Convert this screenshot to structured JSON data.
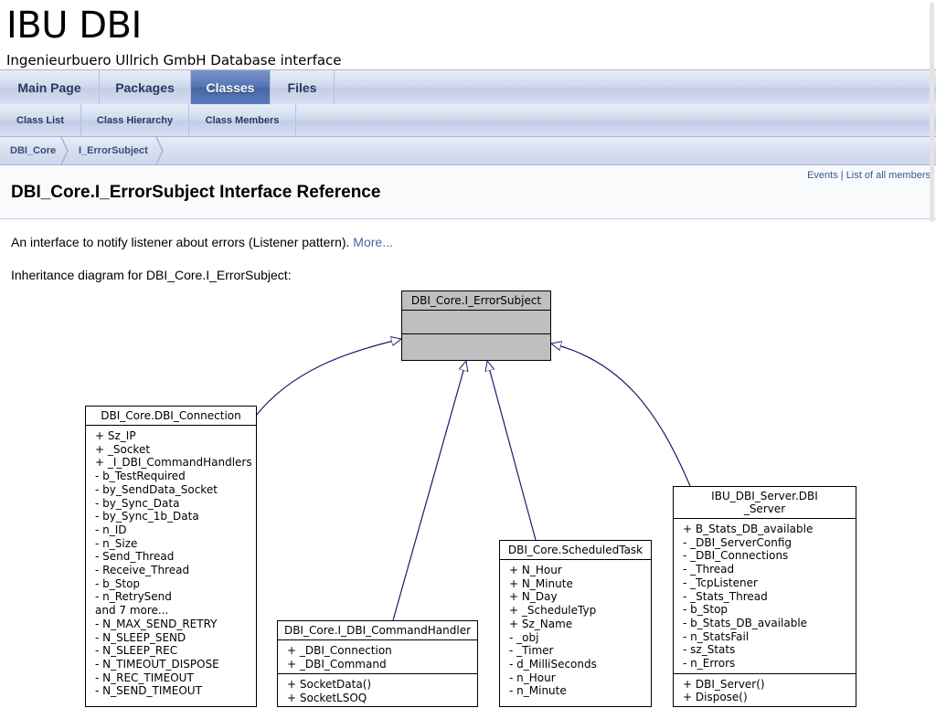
{
  "project": {
    "name": "IBU DBI",
    "brief": "Ingenieurbuero Ullrich GmbH Database interface"
  },
  "tabs": [
    {
      "label": "Main Page",
      "current": false
    },
    {
      "label": "Packages",
      "current": false
    },
    {
      "label": "Classes",
      "current": true
    },
    {
      "label": "Files",
      "current": false
    }
  ],
  "subtabs": [
    {
      "label": "Class List"
    },
    {
      "label": "Class Hierarchy"
    },
    {
      "label": "Class Members"
    }
  ],
  "breadcrumb": [
    "DBI_Core",
    "I_ErrorSubject"
  ],
  "summary": {
    "events": "Events",
    "separator": " | ",
    "all_members": "List of all members"
  },
  "title": "DBI_Core.I_ErrorSubject Interface Reference",
  "brief": {
    "text": "An interface to notify listener about errors (Listener pattern).",
    "more": "More..."
  },
  "inheritance_label": "Inheritance diagram for DBI_Core.I_ErrorSubject:",
  "diagram": {
    "base": {
      "name": "DBI_Core.I_ErrorSubject"
    },
    "connection": {
      "name": "DBI_Core.DBI_Connection",
      "members": [
        "+ Sz_IP",
        "+ _Socket",
        "+ _I_DBI_CommandHandlers",
        "- b_TestRequired",
        "- by_SendData_Socket",
        "- by_Sync_Data",
        "- by_Sync_1b_Data",
        "- n_ID",
        "- n_Size",
        "- Send_Thread",
        "- Receive_Thread",
        "- b_Stop",
        "- n_RetrySend",
        "and 7 more...",
        "- N_MAX_SEND_RETRY",
        "- N_SLEEP_SEND",
        "- N_SLEEP_REC",
        "- N_TIMEOUT_DISPOSE",
        "- N_REC_TIMEOUT",
        "- N_SEND_TIMEOUT"
      ]
    },
    "command_handler": {
      "name": "DBI_Core.I_DBI_CommandHandler",
      "members": [
        "+ _DBI_Connection",
        "+ _DBI_Command"
      ],
      "methods": [
        "+ SocketData()",
        "+ SocketLSOQ"
      ]
    },
    "scheduled_task": {
      "name": "DBI_Core.ScheduledTask",
      "members": [
        "+ N_Hour",
        "+ N_Minute",
        "+ N_Day",
        "+ _ScheduleTyp",
        "+ Sz_Name",
        "- _obj",
        "- _Timer",
        "- d_MilliSeconds",
        "- n_Hour",
        "- n_Minute"
      ]
    },
    "server": {
      "name_line1": "IBU_DBI_Server.DBI",
      "name_line2": "_Server",
      "members": [
        "+ B_Stats_DB_available",
        "- _DBI_ServerConfig",
        "- _DBI_Connections",
        "- _Thread",
        "- _TcpListener",
        "- _Stats_Thread",
        "- b_Stop",
        "- b_Stats_DB_available",
        "- n_StatsFail",
        "- sz_Stats",
        "- n_Errors"
      ],
      "methods": [
        "+ DBI_Server()",
        "+ Dispose()"
      ]
    }
  }
}
